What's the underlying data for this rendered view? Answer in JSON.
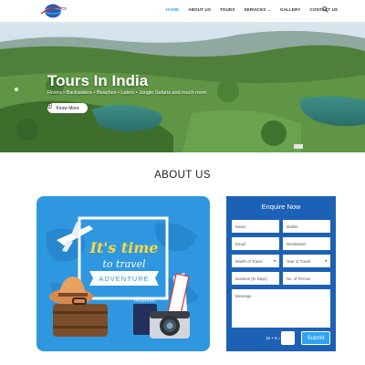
{
  "colors": {
    "accent": "#2ea3f2",
    "form_bg": "#1d61b7",
    "promo_bg": "#2f97e0",
    "nav_text": "#333333"
  },
  "header": {
    "logo_icon": "globe-airplane-logo",
    "nav": {
      "home": "HOME",
      "about": "ABOUT US",
      "tours": "TOURS",
      "services": "SERVICES",
      "gallery": "GALLERY",
      "contact": "CONTACT US"
    },
    "search_icon": "search-icon"
  },
  "hero": {
    "title": "Tours In India",
    "subtitle": "Rivers • Backwaters • Beaches • Lakes • Jungle Safaris and much more",
    "button": "Know More",
    "button_icon": "map-pin-icon"
  },
  "about": {
    "title": "ABOUT US",
    "promo": {
      "line1": "It's time",
      "line2": "to travel",
      "ribbon": "ADVENTURE",
      "passport": "PASSPORT"
    }
  },
  "form": {
    "title": "Enquire Now",
    "name": "Name",
    "mobile": "Mobile",
    "email": "Email",
    "destination": "Destination",
    "month": "Month of Travel",
    "year": "Year of Travel",
    "duration": "Duration (In Days)",
    "persons": "No. of Person",
    "message": "Message",
    "captcha": "15 + 6 =",
    "submit": "Submit"
  }
}
